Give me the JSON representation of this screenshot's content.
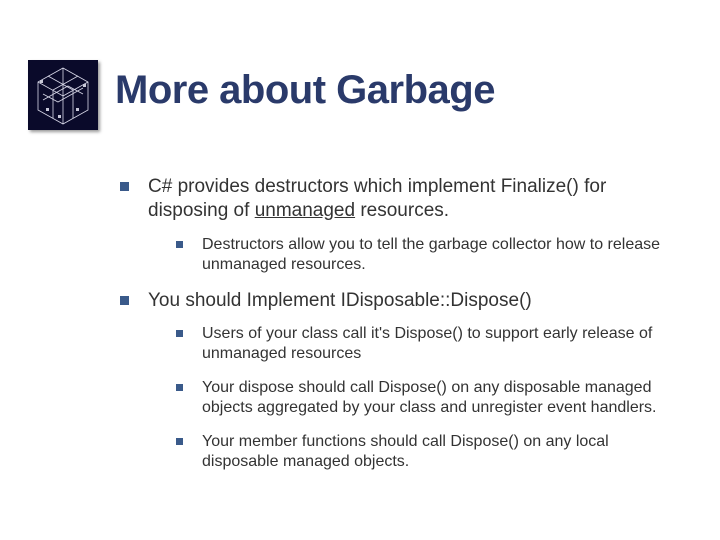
{
  "title": "More about Garbage",
  "bullets": [
    {
      "text_pre": "C# provides destructors which implement Finalize() for disposing of ",
      "text_underlined": "unmanaged",
      "text_post": " resources.",
      "children": [
        {
          "text": "Destructors allow you to tell the garbage collector how to release unmanaged resources."
        }
      ]
    },
    {
      "text": "You should Implement IDisposable::Dispose()",
      "children": [
        {
          "text": "Users of your class call it's Dispose() to support early release of unmanaged resources"
        },
        {
          "text": "Your dispose should call Dispose() on any disposable managed objects aggregated by your class and unregister event handlers."
        },
        {
          "text": "Your member functions should call Dispose() on any local disposable managed objects."
        }
      ]
    }
  ]
}
